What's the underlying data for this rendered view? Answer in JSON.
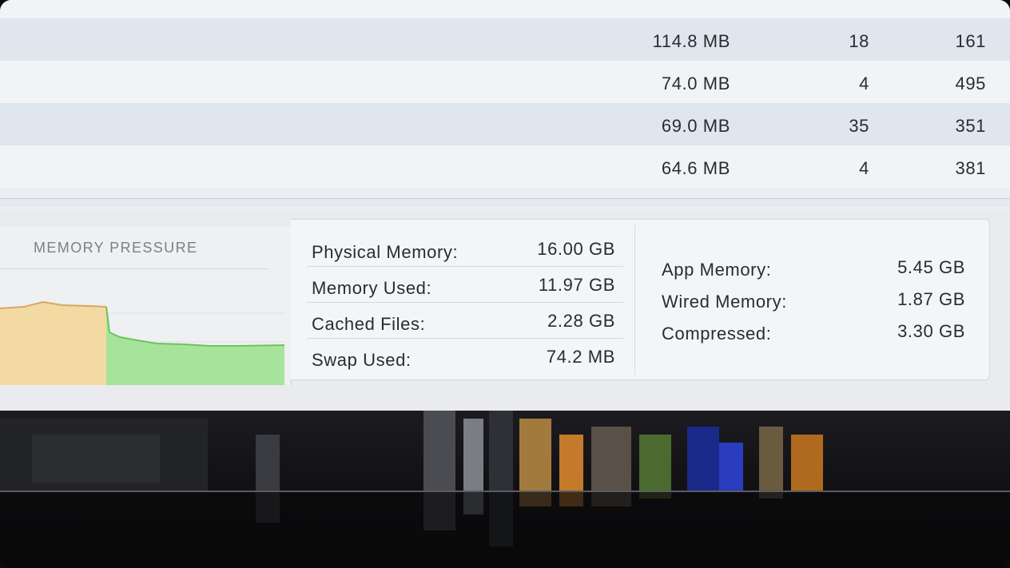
{
  "process_table": {
    "rows": [
      {
        "memory": "114.8 MB",
        "threads": "18",
        "ports": "161"
      },
      {
        "memory": "74.0 MB",
        "threads": "4",
        "ports": "495"
      },
      {
        "memory": "69.0 MB",
        "threads": "35",
        "ports": "351"
      },
      {
        "memory": "64.6 MB",
        "threads": "4",
        "ports": "381"
      }
    ]
  },
  "memory_pressure": {
    "title": "MEMORY PRESSURE",
    "colors": {
      "high": "#f3d9a2",
      "normal": "#a8e39c"
    }
  },
  "memory_stats": {
    "left": [
      {
        "label": "Physical Memory:",
        "value": "16.00 GB"
      },
      {
        "label": "Memory Used:",
        "value": "11.97 GB"
      },
      {
        "label": "Cached Files:",
        "value": "2.28 GB"
      },
      {
        "label": "Swap Used:",
        "value": "74.2 MB"
      }
    ],
    "right": [
      {
        "label": "App Memory:",
        "value": "5.45 GB"
      },
      {
        "label": "Wired Memory:",
        "value": "1.87 GB"
      },
      {
        "label": "Compressed:",
        "value": "3.30 GB"
      }
    ]
  }
}
